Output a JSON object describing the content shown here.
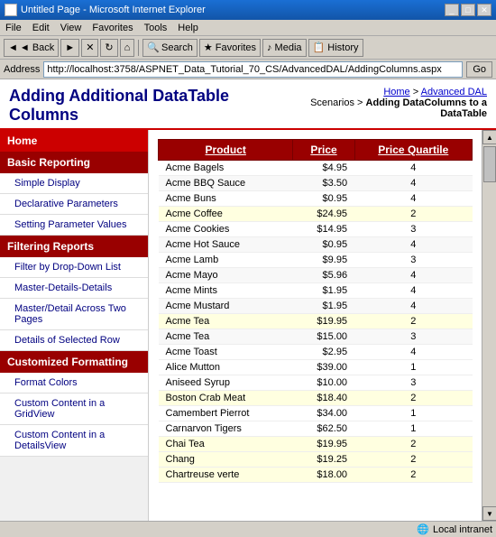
{
  "window": {
    "title": "Untitled Page - Microsoft Internet Explorer",
    "icon": "IE"
  },
  "menu": {
    "items": [
      "File",
      "Edit",
      "View",
      "Favorites",
      "Tools",
      "Help"
    ]
  },
  "toolbar": {
    "back_label": "◄ Back",
    "search_label": "Search",
    "favorites_label": "★ Favorites",
    "media_label": "Media",
    "history_label": "History"
  },
  "address_bar": {
    "label": "Address",
    "url": "http://localhost:3758/ASPNET_Data_Tutorial_70_CS/AdvancedDAL/AddingColumns.aspx",
    "go_label": "Go"
  },
  "breadcrumb": {
    "home": "Home",
    "section": "Advanced DAL",
    "subsection": "Scenarios",
    "current": "Adding DataColumns to a DataTable"
  },
  "page": {
    "title": "Adding Additional DataTable Columns"
  },
  "sidebar": {
    "home_label": "Home",
    "sections": [
      {
        "title": "Basic Reporting",
        "items": [
          {
            "label": "Simple Display",
            "active": false
          },
          {
            "label": "Declarative Parameters",
            "active": false
          },
          {
            "label": "Setting Parameter Values",
            "active": false
          }
        ]
      },
      {
        "title": "Filtering Reports",
        "items": [
          {
            "label": "Filter by Drop-Down List",
            "active": false
          },
          {
            "label": "Master-Details-Details",
            "active": false
          },
          {
            "label": "Master/Detail Across Two Pages",
            "active": false
          },
          {
            "label": "Details of Selected Row",
            "active": false
          }
        ]
      },
      {
        "title": "Customized Formatting",
        "items": [
          {
            "label": "Format Colors",
            "active": false
          },
          {
            "label": "Custom Content in a GridView",
            "active": false
          },
          {
            "label": "Custom Content in a DetailsView",
            "active": false
          }
        ]
      }
    ]
  },
  "table": {
    "columns": [
      "Product",
      "Price",
      "Price Quartile"
    ],
    "rows": [
      {
        "product": "Acme Bagels",
        "price": "$4.95",
        "quartile": "4"
      },
      {
        "product": "Acme BBQ Sauce",
        "price": "$3.50",
        "quartile": "4"
      },
      {
        "product": "Acme Buns",
        "price": "$0.95",
        "quartile": "4"
      },
      {
        "product": "Acme Coffee",
        "price": "$24.95",
        "quartile": "2"
      },
      {
        "product": "Acme Cookies",
        "price": "$14.95",
        "quartile": "3"
      },
      {
        "product": "Acme Hot Sauce",
        "price": "$0.95",
        "quartile": "4"
      },
      {
        "product": "Acme Lamb",
        "price": "$9.95",
        "quartile": "3"
      },
      {
        "product": "Acme Mayo",
        "price": "$5.96",
        "quartile": "4"
      },
      {
        "product": "Acme Mints",
        "price": "$1.95",
        "quartile": "4"
      },
      {
        "product": "Acme Mustard",
        "price": "$1.95",
        "quartile": "4"
      },
      {
        "product": "Acme Tea",
        "price": "$19.95",
        "quartile": "2"
      },
      {
        "product": "Acme Tea",
        "price": "$15.00",
        "quartile": "3"
      },
      {
        "product": "Acme Toast",
        "price": "$2.95",
        "quartile": "4"
      },
      {
        "product": "Alice Mutton",
        "price": "$39.00",
        "quartile": "1"
      },
      {
        "product": "Aniseed Syrup",
        "price": "$10.00",
        "quartile": "3"
      },
      {
        "product": "Boston Crab Meat",
        "price": "$18.40",
        "quartile": "2"
      },
      {
        "product": "Camembert Pierrot",
        "price": "$34.00",
        "quartile": "1"
      },
      {
        "product": "Carnarvon Tigers",
        "price": "$62.50",
        "quartile": "1"
      },
      {
        "product": "Chai Tea",
        "price": "$19.95",
        "quartile": "2"
      },
      {
        "product": "Chang",
        "price": "$19.25",
        "quartile": "2"
      },
      {
        "product": "Chartreuse verte",
        "price": "$18.00",
        "quartile": "2"
      }
    ]
  },
  "status": {
    "text": "",
    "zone": "Local intranet"
  }
}
